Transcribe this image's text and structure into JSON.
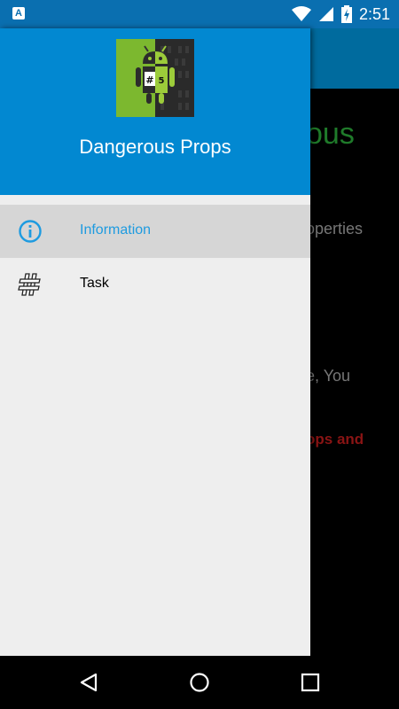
{
  "status_bar": {
    "notification_icon": "accessibility-icon",
    "notification_glyph": "A",
    "icons": [
      "wifi-icon",
      "signal-icon",
      "battery-charging-icon"
    ],
    "time": "2:51",
    "color": "#0a6fb0"
  },
  "background_app": {
    "title_fragment": "ous",
    "line1_fragment": "operties",
    "line2_fragment": "e, You",
    "line3_fragment": "ops and"
  },
  "drawer": {
    "header_color": "#0288d1",
    "logo": "dangerous-props-logo",
    "app_name": "Dangerous Props",
    "items": [
      {
        "label": "Information",
        "icon": "info-icon",
        "selected": true,
        "color": "#1e9be0"
      },
      {
        "label": "Task",
        "icon": "hash-icon",
        "selected": false
      }
    ]
  },
  "nav_bar": {
    "buttons": [
      "back-icon",
      "home-icon",
      "recents-icon"
    ]
  }
}
